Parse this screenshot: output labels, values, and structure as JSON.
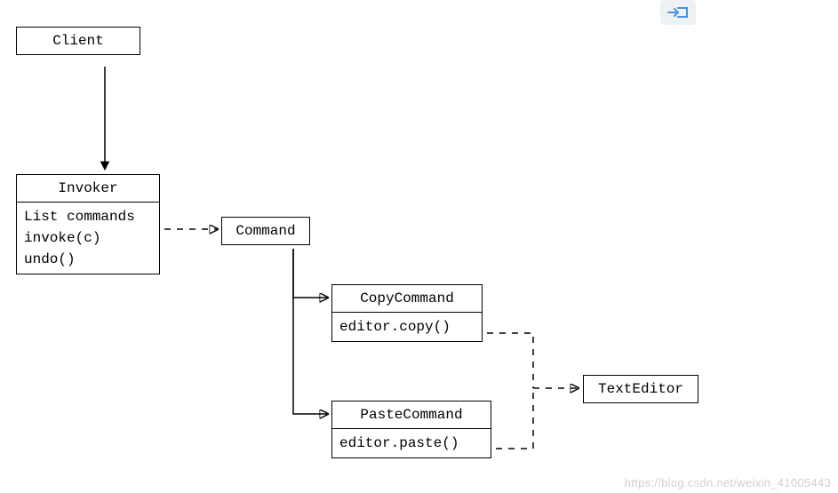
{
  "diagram": {
    "client": {
      "title": "Client"
    },
    "invoker": {
      "title": "Invoker",
      "line1": "List commands",
      "line2": "invoke(c)",
      "line3": "undo()"
    },
    "command": {
      "title": "Command"
    },
    "copy_command": {
      "title": "CopyCommand",
      "body": "editor.copy()"
    },
    "paste_command": {
      "title": "PasteCommand",
      "body": "editor.paste()"
    },
    "text_editor": {
      "title": "TextEditor"
    }
  },
  "watermark": "https://blog.csdn.net/weixin_41005443"
}
